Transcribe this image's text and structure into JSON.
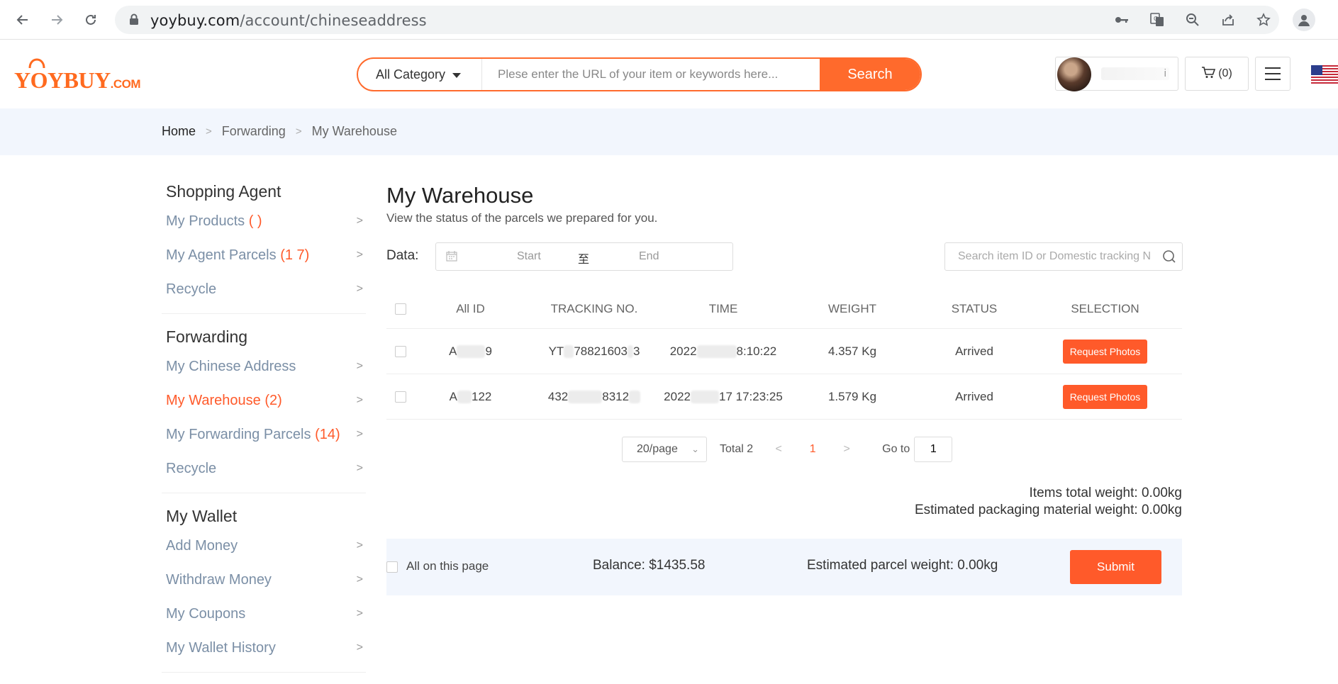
{
  "browser": {
    "url_domain": "yoybuy.com",
    "url_path": "/account/chineseaddress"
  },
  "header": {
    "logo_text": "YOYBUY",
    "logo_suffix": ".COM",
    "category": "All Category",
    "search_placeholder": "Plese enter the URL of your item or keywords here...",
    "search_button": "Search",
    "user_name_fragment": "i",
    "cart_label": "(0)"
  },
  "breadcrumb": {
    "home": "Home",
    "forwarding": "Forwarding",
    "current": "My Warehouse"
  },
  "sidebar": {
    "groups": [
      {
        "title": "Shopping Agent",
        "items": [
          {
            "label": "My Products ",
            "count": "(   )"
          },
          {
            "label": "My Agent Parcels ",
            "count": "(1  7)"
          },
          {
            "label": "Recycle",
            "count": ""
          }
        ]
      },
      {
        "title": "Forwarding",
        "items": [
          {
            "label": "My Chinese Address",
            "count": ""
          },
          {
            "label": "My Warehouse ",
            "count": "(2)"
          },
          {
            "label": "My Forwarding Parcels ",
            "count": "(14)"
          },
          {
            "label": "Recycle",
            "count": ""
          }
        ]
      },
      {
        "title": "My Wallet",
        "items": [
          {
            "label": "Add Money",
            "count": ""
          },
          {
            "label": "Withdraw Money",
            "count": ""
          },
          {
            "label": "My Coupons",
            "count": ""
          },
          {
            "label": "My Wallet History",
            "count": ""
          }
        ]
      }
    ]
  },
  "main": {
    "title": "My Warehouse",
    "subtitle": "View the status of the parcels we prepared for you.",
    "data_label": "Data:",
    "date_start": "Start",
    "date_to": "至",
    "date_end": "End",
    "search_placeholder": "Search item ID or Domestic tracking N",
    "columns": [
      "All ID",
      "TRACKING NO.",
      "TIME",
      "WEIGHT",
      "STATUS",
      "SELECTION"
    ],
    "rows": [
      {
        "id_a": "A",
        "id_b": "9",
        "trk_a": "YT",
        "trk_b": "78821603",
        "trk_c": "3",
        "time_a": "2022",
        "time_b": "8:10:22",
        "weight": "4.357 Kg",
        "status": "Arrived",
        "action": "Request Photos"
      },
      {
        "id_a": "A",
        "id_b": "122",
        "trk_a": "432",
        "trk_b": "8312",
        "trk_c": "",
        "time_a": "2022",
        "time_b": "17 17:23:25",
        "weight": "1.579 Kg",
        "status": "Arrived",
        "action": "Request Photos"
      }
    ],
    "pager": {
      "size": "20/page",
      "total": "Total 2",
      "current": "1",
      "goto_label": "Go to",
      "goto_value": "1"
    },
    "items_weight": "Items total weight: 0.00kg",
    "packaging_weight": "Estimated packaging material weight: 0.00kg",
    "all_on_page": "All on this page",
    "balance": "Balance: $1435.58",
    "est_parcel": "Estimated parcel weight: 0.00kg",
    "submit": "Submit"
  },
  "colors": {
    "accent": "#ff5a2a",
    "breadcrumb_bg": "#f2f6fd",
    "sidebar_link": "#7b8fa6"
  }
}
